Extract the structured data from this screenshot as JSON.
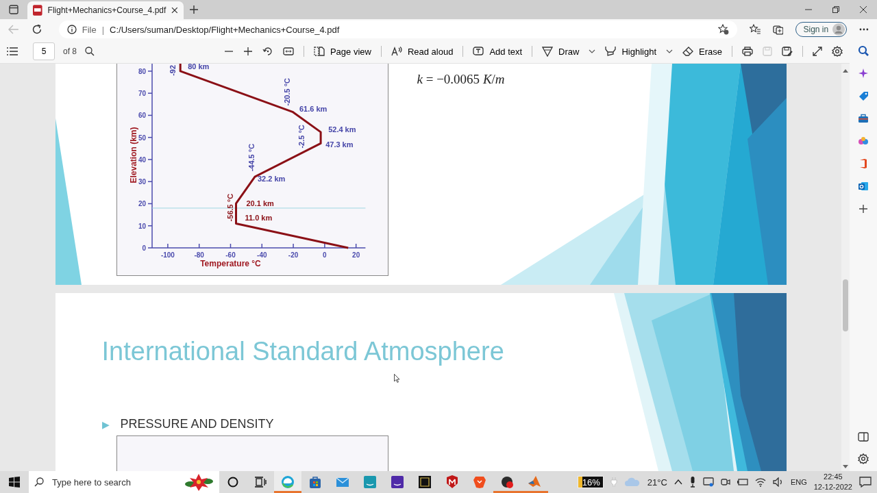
{
  "browser": {
    "tab_title": "Flight+Mechanics+Course_4.pdf",
    "address_prefix": "File",
    "address_separator": "|",
    "address": "C:/Users/suman/Desktop/Flight+Mechanics+Course_4.pdf",
    "sign_in": "Sign in"
  },
  "pdf_toolbar": {
    "page": "5",
    "page_count": "of 8",
    "tools": [
      {
        "kind": "page-view",
        "label": "Page view",
        "dropdown": false
      },
      {
        "kind": "read-aloud",
        "label": "Read aloud",
        "dropdown": false
      },
      {
        "kind": "add-text",
        "label": "Add text",
        "dropdown": false
      },
      {
        "kind": "draw",
        "label": "Draw",
        "dropdown": true
      },
      {
        "kind": "highlight",
        "label": "Highlight",
        "dropdown": true
      },
      {
        "kind": "erase",
        "label": "Erase",
        "dropdown": false
      }
    ]
  },
  "page_top": {
    "formula": "*k* = −0.0065 *K*/*m*",
    "chart_data": {
      "type": "line",
      "xlabel": "Temperature °C",
      "ylabel": "Elevation (km)",
      "x": [
        15,
        -56.5,
        -56.5,
        -44.5,
        -2.5,
        -2.5,
        -20.5,
        -92,
        -92
      ],
      "values": [
        0,
        11,
        20.1,
        32.2,
        47.3,
        52.4,
        61.6,
        80,
        84
      ],
      "ref_lines": [
        {
          "axis": "y",
          "value": 18
        }
      ],
      "xlim": [
        -110,
        26
      ],
      "ylim": [
        0,
        84
      ],
      "xticks": [
        -100,
        -80,
        -60,
        -40,
        -20,
        0,
        20
      ],
      "yticks": [
        0,
        10,
        20,
        30,
        40,
        50,
        60,
        70,
        80
      ],
      "annotations": [
        {
          "text": "80 km",
          "x": -92,
          "y": 80
        },
        {
          "text": "-92",
          "x": -92,
          "y": 80
        },
        {
          "text": "-20.5 °C",
          "x": -20.5,
          "y": 61.6
        },
        {
          "text": "61.6 km",
          "x": -20.5,
          "y": 61.6
        },
        {
          "text": "52.4 km",
          "x": -2.5,
          "y": 52.4
        },
        {
          "text": "-2.5 °C",
          "x": -2.5,
          "y": 47.3
        },
        {
          "text": "47.3 km",
          "x": -2.5,
          "y": 47.3
        },
        {
          "text": "-44.5 °C",
          "x": -44.5,
          "y": 32.2
        },
        {
          "text": "32.2 km",
          "x": -44.5,
          "y": 32.2
        },
        {
          "text": "-56.5 °C",
          "x": -56.5,
          "y": 20.1
        },
        {
          "text": "20.1 km",
          "x": -56.5,
          "y": 20.1
        },
        {
          "text": "11.0 km",
          "x": -56.5,
          "y": 11
        }
      ]
    }
  },
  "page_bottom": {
    "title": "International Standard Atmosphere",
    "bullet_mark": "▶",
    "bullet": "PRESSURE AND DENSITY"
  },
  "taskbar": {
    "search_placeholder": "Type here to search",
    "apps": [
      {
        "kind": "edge",
        "active": true
      },
      {
        "kind": "store",
        "active": false
      },
      {
        "kind": "mail",
        "active": false
      },
      {
        "kind": "video",
        "active": false
      },
      {
        "kind": "music",
        "active": false
      },
      {
        "kind": "wb",
        "active": false
      },
      {
        "kind": "shield",
        "active": false
      },
      {
        "kind": "lion",
        "active": false
      },
      {
        "kind": "recorder",
        "active": true
      },
      {
        "kind": "matlab",
        "active": true
      }
    ]
  },
  "tray": {
    "battery": {
      "reading": "16%",
      "level": 0.16
    },
    "temperature": "21°C",
    "language": "ENG",
    "time": "22:45",
    "date": "12-12-2022"
  }
}
